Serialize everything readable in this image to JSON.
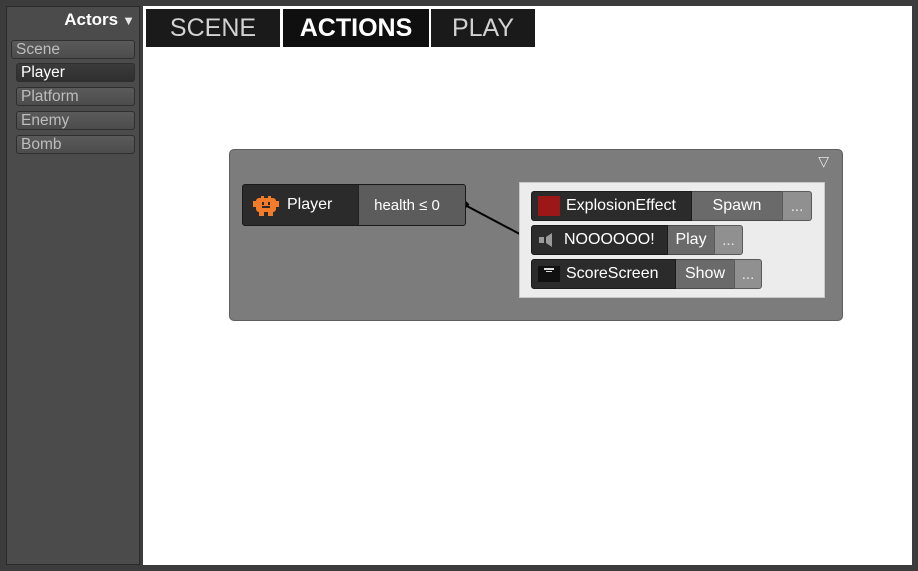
{
  "sidebar": {
    "title": "Actors",
    "toggle_icon": "triangle-down-icon",
    "items": [
      {
        "label": "Scene",
        "selected": false
      },
      {
        "label": "Player",
        "selected": true
      },
      {
        "label": "Platform",
        "selected": false
      },
      {
        "label": "Enemy",
        "selected": false
      },
      {
        "label": "Bomb",
        "selected": false
      }
    ]
  },
  "tabs": [
    {
      "label": "SCENE",
      "active": false
    },
    {
      "label": "ACTIONS",
      "active": true
    },
    {
      "label": "PLAY",
      "active": false
    }
  ],
  "rule": {
    "collapse_icon": "triangle-down-outline-icon",
    "trigger": {
      "actor_icon": "player-sprite-icon",
      "actor": "Player",
      "condition": "health ≤ 0"
    },
    "actions": [
      {
        "icon": "red-swatch-icon",
        "target": "ExplosionEffect",
        "verb": "Spawn",
        "more": "..."
      },
      {
        "icon": "speaker-icon",
        "target": "NOOOOOO!",
        "verb": "Play",
        "more": "..."
      },
      {
        "icon": "screen-icon",
        "target": "ScoreScreen",
        "verb": "Show",
        "more": "..."
      }
    ]
  },
  "colors": {
    "background": "#3c3c3c",
    "canvas": "#ffffff",
    "panel": "#7c7c7c",
    "player_orange": "#f47b2a",
    "explosion_red": "#9c1818"
  }
}
